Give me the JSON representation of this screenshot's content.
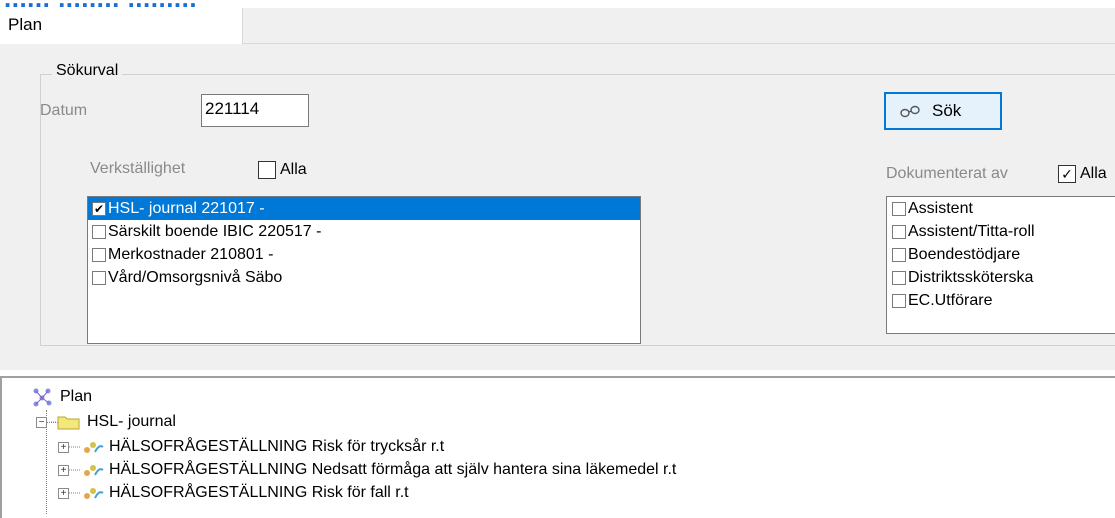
{
  "window": {
    "title_partial": "...... ........ .........",
    "tab_label": "Plan"
  },
  "search": {
    "group_title": "Sökurval",
    "datum_label": "Datum",
    "datum_value": "221114",
    "search_button_label": "Sök",
    "verkstallighet_label": "Verkställighet",
    "alla_label_left": "Alla",
    "alla_left_checked": false,
    "dokumenterat_label": "Dokumenterat av",
    "alla_label_right": "Alla",
    "alla_right_checked": true
  },
  "verkstallighet_list": [
    {
      "label": "HSL- journal 221017 -",
      "checked": true,
      "selected": true
    },
    {
      "label": "Särskilt boende IBIC 220517 -",
      "checked": false,
      "selected": false
    },
    {
      "label": "Merkostnader 210801 -",
      "checked": false,
      "selected": false
    },
    {
      "label": "Vård/Omsorgsnivå Säbo",
      "checked": false,
      "selected": false
    }
  ],
  "dokumenterat_list": [
    {
      "label": "Assistent",
      "checked": false
    },
    {
      "label": "Assistent/Titta-roll",
      "checked": false
    },
    {
      "label": "Boendestödjare",
      "checked": false
    },
    {
      "label": "Distriktssköterska",
      "checked": false
    },
    {
      "label": "EC.Utförare",
      "checked": false
    }
  ],
  "tree": {
    "root_label": "Plan",
    "folder_label": "HSL- journal",
    "items": [
      "HÄLSOFRÅGESTÄLLNING Risk för trycksår r.t",
      "HÄLSOFRÅGESTÄLLNING Nedsatt förmåga att själv hantera sina läkemedel r.t",
      "HÄLSOFRÅGESTÄLLNING Risk för fall r.t"
    ]
  },
  "colors": {
    "selection": "#0078d7",
    "panel": "#f0f0f0",
    "button_bg": "#e5f1fb"
  }
}
